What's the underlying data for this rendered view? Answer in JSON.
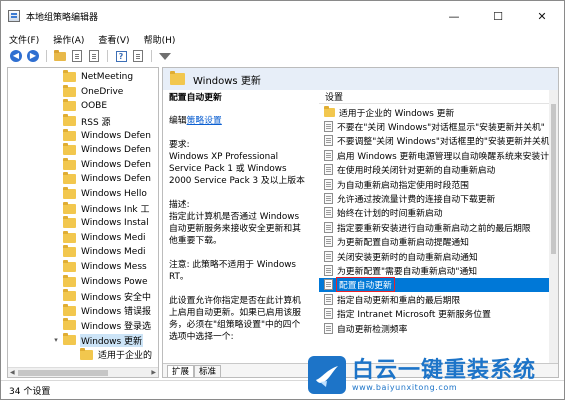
{
  "window": {
    "title": "本地组策略编辑器",
    "minimize": "—",
    "maximize": "☐",
    "close": "✕"
  },
  "menu": [
    "文件(F)",
    "操作(A)",
    "查看(V)",
    "帮助(H)"
  ],
  "toolbar": {
    "icons": [
      "back-arrow-icon",
      "forward-arrow-icon",
      "folder-up-icon",
      "document-icon",
      "list-view-icon",
      "help-icon",
      "properties-icon",
      "filter-icon"
    ]
  },
  "tree": {
    "items": [
      {
        "label": "NetMeeting",
        "selected": false
      },
      {
        "label": "OneDrive",
        "selected": false
      },
      {
        "label": "OOBE",
        "selected": false
      },
      {
        "label": "RSS 源",
        "selected": false
      },
      {
        "label": "Windows Defen",
        "selected": false
      },
      {
        "label": "Windows Defen",
        "selected": false
      },
      {
        "label": "Windows Defen",
        "selected": false
      },
      {
        "label": "Windows Defen",
        "selected": false
      },
      {
        "label": "Windows Hello",
        "selected": false
      },
      {
        "label": "Windows Ink 工",
        "selected": false
      },
      {
        "label": "Windows Instal",
        "selected": false
      },
      {
        "label": "Windows Medi",
        "selected": false
      },
      {
        "label": "Windows Medi",
        "selected": false
      },
      {
        "label": "Windows Mess",
        "selected": false
      },
      {
        "label": "Windows Powe",
        "selected": false
      },
      {
        "label": "Windows 安全中",
        "selected": false
      },
      {
        "label": "Windows 错误报",
        "selected": false
      },
      {
        "label": "Windows 登录选",
        "selected": false
      },
      {
        "label": "Windows 更新",
        "selected": true
      },
      {
        "label": "适用于企业的",
        "selected": false
      }
    ]
  },
  "right": {
    "header": "Windows 更新",
    "policy_title": "配置自动更新",
    "edit_prefix": "编辑",
    "edit_link": "策略设置",
    "requirements_label": "要求:",
    "requirements": "Windows XP Professional Service Pack 1 或 Windows 2000 Service Pack 3 及以上版本",
    "description_label": "描述:",
    "description": "指定此计算机是否通过 Windows 自动更新服务来接收安全更新和其他重要下载。",
    "note": "注意: 此策略不适用于 Windows RT。",
    "detail": "此设置允许你指定是否在此计算机上启用自动更新。如果已启用该服务，必须在\"组策略设置\"中的四个选项中选择一个:",
    "list_header": "设置",
    "list": [
      {
        "text": "适用于企业的 Windows 更新",
        "folder": true,
        "selected": false
      },
      {
        "text": "不要在\"关闭 Windows\"对话框显示\"安装更新并关机\"",
        "folder": false,
        "selected": false
      },
      {
        "text": "不要调整\"关闭 Windows\"对话框里的\"安装更新并关机\"",
        "folder": false,
        "selected": false
      },
      {
        "text": "启用 Windows 更新电源管理以自动唤醒系统来安装计",
        "folder": false,
        "selected": false
      },
      {
        "text": "在使用时段关闭针对更新的自动重新启动",
        "folder": false,
        "selected": false
      },
      {
        "text": "为自动重新启动指定使用时段范围",
        "folder": false,
        "selected": false
      },
      {
        "text": "允许通过按流量计费的连接自动下载更新",
        "folder": false,
        "selected": false
      },
      {
        "text": "始终在计划的时间重新启动",
        "folder": false,
        "selected": false
      },
      {
        "text": "指定要重新安装进行自动重新启动之前的最后期限",
        "folder": false,
        "selected": false
      },
      {
        "text": "为更新配置自动重新启动提醒通知",
        "folder": false,
        "selected": false
      },
      {
        "text": "关闭安装更新时的自动重新启动通知",
        "folder": false,
        "selected": false
      },
      {
        "text": "为更新配置\"需要自动重新启动\"通知",
        "folder": false,
        "selected": false
      },
      {
        "text": "配置自动更新",
        "folder": false,
        "selected": true
      },
      {
        "text": "指定自动更新和重启的最后期限",
        "folder": false,
        "selected": false
      },
      {
        "text": "指定 Intranet Microsoft 更新服务位置",
        "folder": false,
        "selected": false
      },
      {
        "text": "自动更新检测频率",
        "folder": false,
        "selected": false
      }
    ],
    "tabs": [
      "扩展",
      "标准"
    ]
  },
  "status": "34 个设置",
  "watermark": {
    "title": "白云一键重装系统",
    "url": "www.baiyunxitong.com",
    "color": "#1d74c8"
  },
  "colors": {
    "selection": "#0078d7",
    "highlight_box": "#e8232a",
    "tree_selected": "#cce4f7"
  }
}
